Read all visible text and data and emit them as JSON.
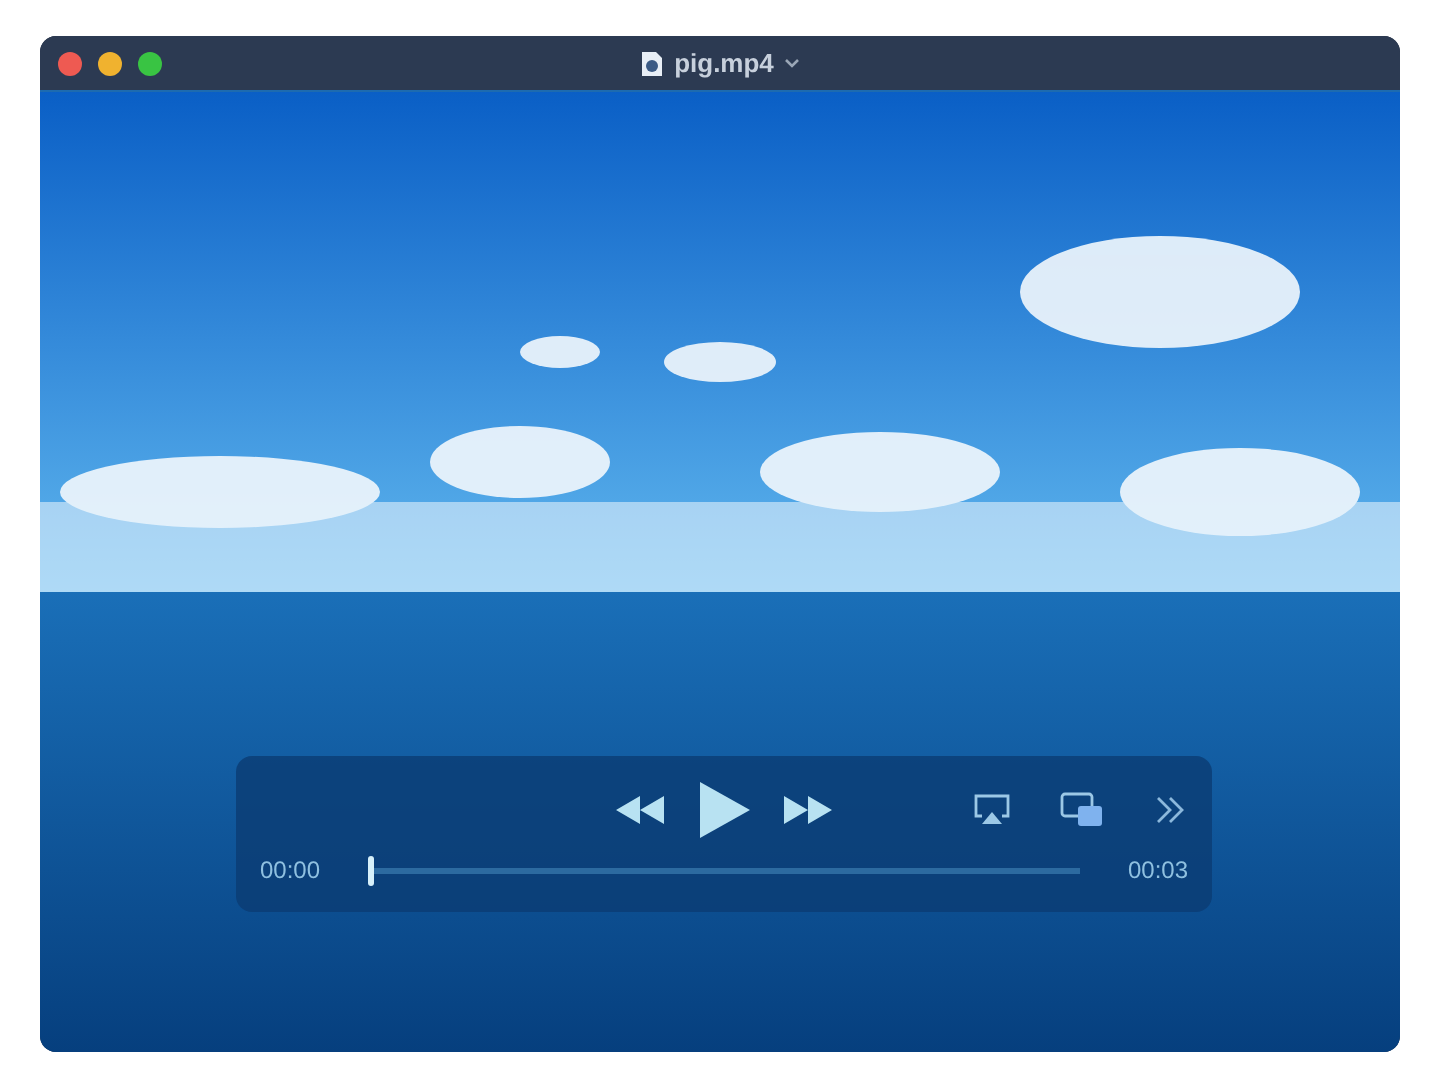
{
  "window": {
    "title": "pig.mp4"
  },
  "player": {
    "current_time": "00:00",
    "duration": "00:03",
    "progress": {
      "level": 0
    }
  }
}
